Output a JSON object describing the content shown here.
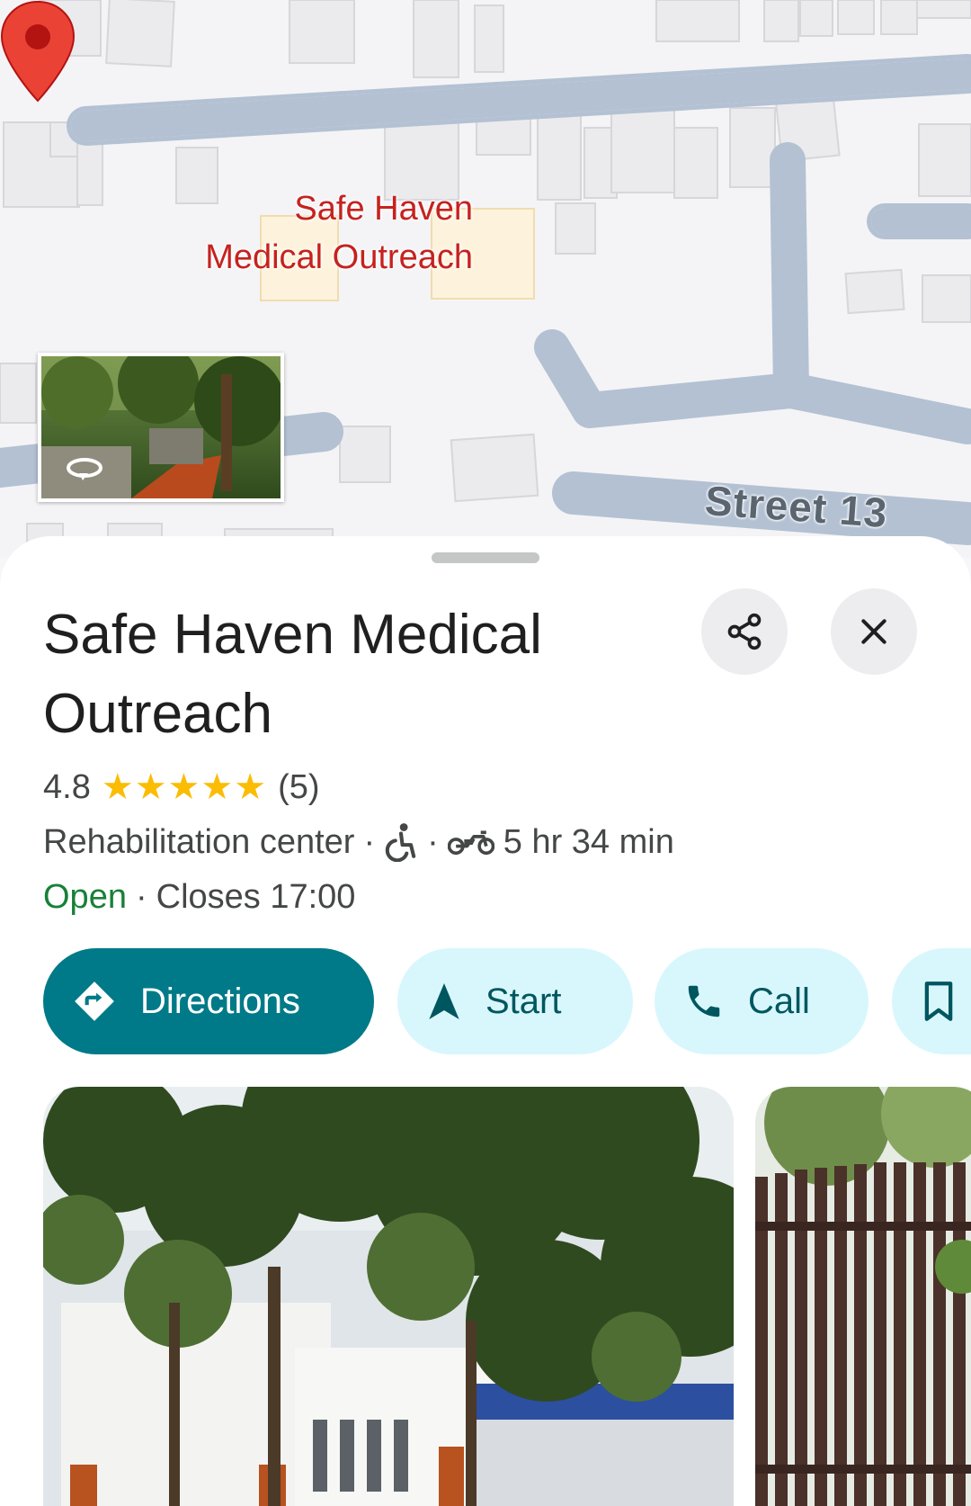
{
  "map": {
    "pin_label_line1": "Safe Haven",
    "pin_label_line2": "Medical Outreach",
    "street_label": "Street 13",
    "pin_color": "#ea4335"
  },
  "place": {
    "title": "Safe Haven Medical Outreach",
    "rating": "4.8",
    "stars": "★★★★★",
    "review_count": "(5)",
    "category": "Rehabilitation center",
    "separator": "·",
    "travel_time": "5 hr 34 min",
    "status": "Open",
    "closes": "Closes 17:00"
  },
  "actions": {
    "directions": "Directions",
    "start": "Start",
    "call": "Call"
  },
  "colors": {
    "primary": "#007a88",
    "secondary_bg": "#d8f7fd",
    "star": "#fbbc04",
    "open": "#188038"
  }
}
